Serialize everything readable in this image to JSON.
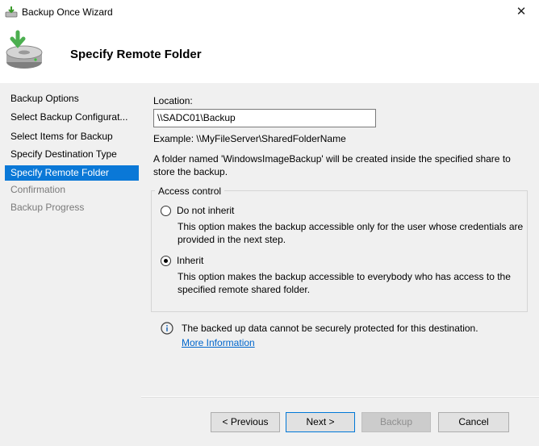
{
  "window": {
    "title": "Backup Once Wizard",
    "close_glyph": "✕"
  },
  "header": {
    "title": "Specify Remote Folder",
    "icon": "backup-drive-icon"
  },
  "sidebar": {
    "items": [
      {
        "label": "Backup Options",
        "state": "normal"
      },
      {
        "label": "Select Backup Configurat...",
        "state": "normal"
      },
      {
        "label": "Select Items for Backup",
        "state": "normal"
      },
      {
        "label": "Specify Destination Type",
        "state": "normal"
      },
      {
        "label": "Specify Remote Folder",
        "state": "active"
      },
      {
        "label": "Confirmation",
        "state": "disabled"
      },
      {
        "label": "Backup Progress",
        "state": "disabled"
      }
    ]
  },
  "main": {
    "location_label": "Location:",
    "location_value": "\\\\SADC01\\Backup",
    "example": "Example: \\\\MyFileServer\\SharedFolderName",
    "note_line1": "A folder named 'WindowsImageBackup' will be created inside the specified share to",
    "note_line2": "store the backup.",
    "access_control": {
      "legend": "Access control",
      "options": [
        {
          "label": "Do not inherit",
          "desc_line1": "This option makes the backup accessible only for the user whose credentials are",
          "desc_line2": "provided in the next step.",
          "selected": false
        },
        {
          "label": "Inherit",
          "desc_line1": "This option makes the backup accessible to everybody who has access to the",
          "desc_line2": "specified remote shared folder.",
          "selected": true
        }
      ]
    },
    "info_text": "The backed up data cannot be securely protected for this destination.",
    "more_info_link": "More Information"
  },
  "buttons": {
    "previous": "< Previous",
    "next": "Next >",
    "backup": "Backup",
    "cancel": "Cancel"
  },
  "colors": {
    "accent": "#0a78d7",
    "panel_bg": "#f0f0f0",
    "link": "#0066cc"
  }
}
